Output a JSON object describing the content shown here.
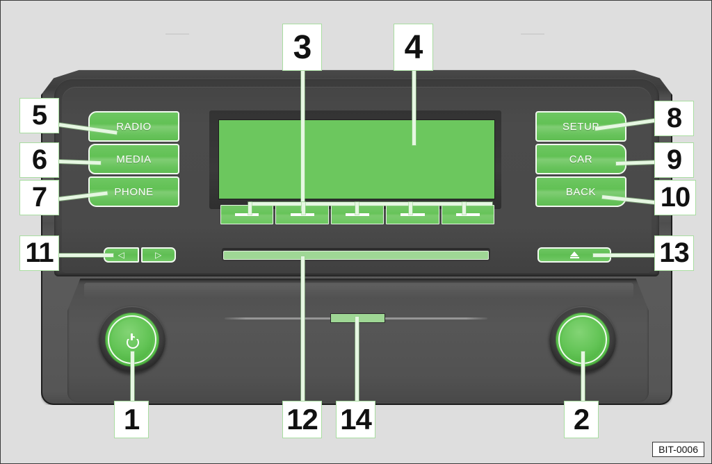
{
  "figure": {
    "image_id": "BIT-0006",
    "background_color": "#dedede",
    "accent_green": "#6cc75e",
    "callout_box_border": "#a8dda0"
  },
  "device": {
    "name": "car-radio-head-unit",
    "display_label": "display-screen",
    "softkeys": [
      {
        "label": "",
        "name": "softkey-1"
      },
      {
        "label": "",
        "name": "softkey-2"
      },
      {
        "label": "",
        "name": "softkey-3"
      },
      {
        "label": "",
        "name": "softkey-4"
      },
      {
        "label": "",
        "name": "softkey-5"
      }
    ],
    "left_buttons": [
      {
        "label": "RADIO"
      },
      {
        "label": "MEDIA"
      },
      {
        "label": "PHONE"
      }
    ],
    "right_buttons": [
      {
        "label": "SETUP"
      },
      {
        "label": "CAR"
      },
      {
        "label": "BACK"
      }
    ],
    "skip_buttons": [
      {
        "glyph": "◁",
        "name": "skip-previous-button"
      },
      {
        "glyph": "▷",
        "name": "skip-next-button"
      }
    ],
    "eject_button": {
      "glyph": "▲",
      "name": "eject-button"
    },
    "power_knob": {
      "glyph": "⏻",
      "name": "power-volume-knob"
    },
    "tuning_knob": {
      "glyph": "",
      "name": "tuning-menu-knob"
    },
    "cd_slot": {
      "name": "cd-slot"
    },
    "sd_slot": {
      "name": "sd-card-slot"
    }
  },
  "callouts": [
    {
      "number": "1",
      "target": "power-volume-knob"
    },
    {
      "number": "2",
      "target": "tuning-menu-knob"
    },
    {
      "number": "3",
      "target": "softkey-row"
    },
    {
      "number": "4",
      "target": "display-screen"
    },
    {
      "number": "5",
      "target": "radio-button"
    },
    {
      "number": "6",
      "target": "media-button"
    },
    {
      "number": "7",
      "target": "phone-button"
    },
    {
      "number": "8",
      "target": "setup-button"
    },
    {
      "number": "9",
      "target": "car-button"
    },
    {
      "number": "10",
      "target": "back-button"
    },
    {
      "number": "11",
      "target": "skip-buttons"
    },
    {
      "number": "12",
      "target": "cd-slot"
    },
    {
      "number": "13",
      "target": "eject-button"
    },
    {
      "number": "14",
      "target": "sd-card-slot"
    }
  ]
}
